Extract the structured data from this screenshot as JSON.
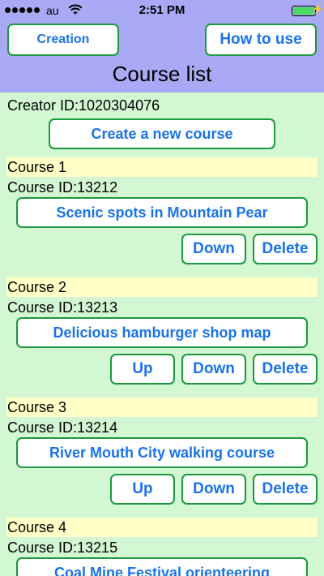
{
  "status": {
    "carrier": "au",
    "time": "2:51 PM",
    "battery_level": 1.0
  },
  "header": {
    "creation_label": "Creation",
    "howto_label": "How to use",
    "title": "Course list"
  },
  "creator": {
    "id_text": "Creator ID:1020304076",
    "new_course_label": "Create a new course"
  },
  "courses": [
    {
      "label": "Course 1",
      "id_text": "Course ID:13212",
      "name": "Scenic spots in Mountain Pear",
      "up": "",
      "down": "Down",
      "delete": "Delete"
    },
    {
      "label": "Course 2",
      "id_text": "Course ID:13213",
      "name": "Delicious hamburger shop map",
      "up": "Up",
      "down": "Down",
      "delete": "Delete"
    },
    {
      "label": "Course 3",
      "id_text": "Course ID:13214",
      "name": "River Mouth City walking course",
      "up": "Up",
      "down": "Down",
      "delete": "Delete"
    },
    {
      "label": "Course 4",
      "id_text": "Course ID:13215",
      "name": "Coal Mine Festival orienteering",
      "up": "",
      "down": "",
      "delete": ""
    }
  ],
  "icons": {
    "signal": "signal-dots-icon",
    "wifi": "wifi-icon",
    "battery": "battery-icon",
    "charging": "charging-bolt-icon"
  },
  "colors": {
    "header_bg": "#a9a9f5",
    "content_bg": "#d2f7d2",
    "course_label_bg": "#ffffc8",
    "button_border": "#1a9a3c",
    "button_text": "#1a73e8"
  }
}
